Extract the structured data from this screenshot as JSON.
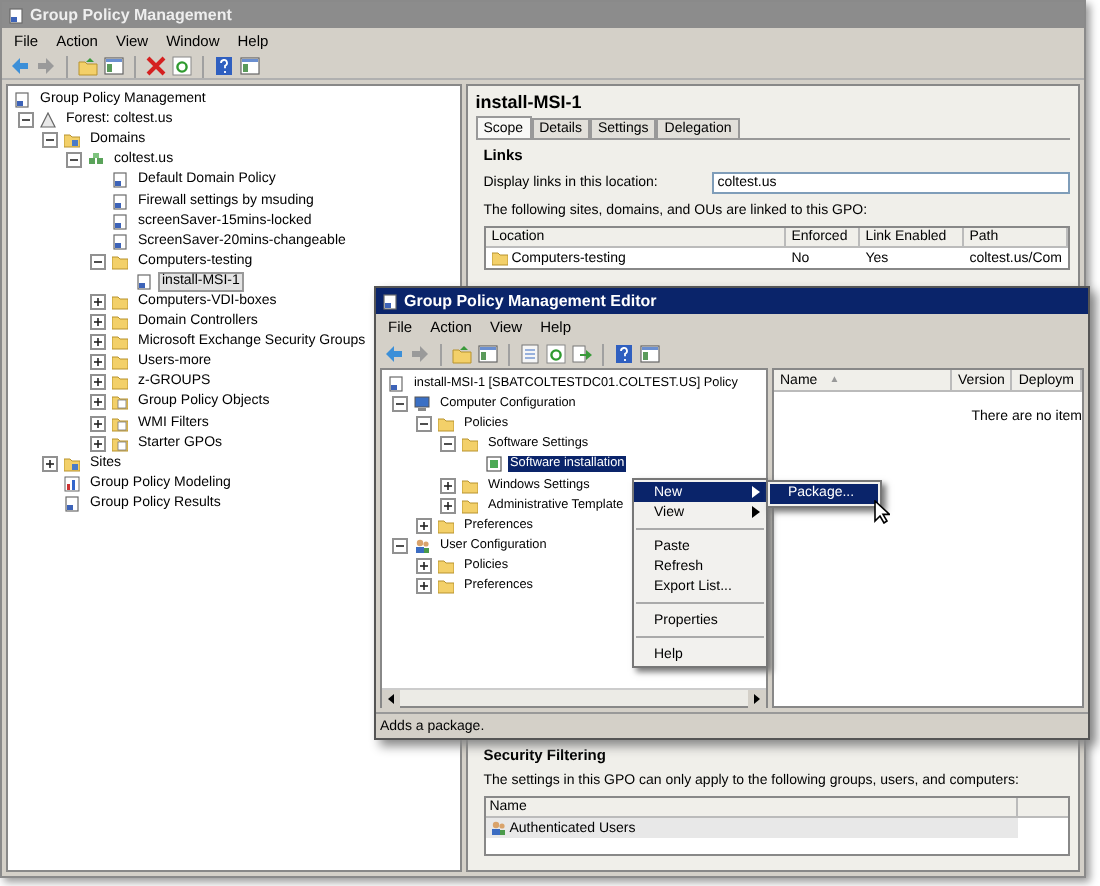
{
  "main_window": {
    "title": "Group Policy Management",
    "menu": [
      "File",
      "Action",
      "View",
      "Window",
      "Help"
    ],
    "tree": [
      {
        "label": "Group Policy Management",
        "kind": "console",
        "selected": false,
        "children": [
          {
            "label": "Forest: coltest.us",
            "kind": "forest",
            "expanded": true,
            "selected": false,
            "children": [
              {
                "label": "Domains",
                "kind": "domains",
                "expanded": true,
                "selected": false,
                "children": [
                  {
                    "label": "coltest.us",
                    "kind": "domain",
                    "expanded": true,
                    "selected": false,
                    "children": [
                      {
                        "label": "Default Domain Policy",
                        "kind": "gpo",
                        "selected": false
                      },
                      {
                        "label": "Firewall settings by msuding",
                        "kind": "gpo",
                        "selected": false
                      },
                      {
                        "label": "screenSaver-15mins-locked",
                        "kind": "gpo",
                        "selected": false
                      },
                      {
                        "label": "ScreenSaver-20mins-changeable",
                        "kind": "gpo",
                        "selected": false
                      },
                      {
                        "label": "Computers-testing",
                        "kind": "folder",
                        "expanded": true,
                        "selected": false,
                        "children": [
                          {
                            "label": "install-MSI-1",
                            "kind": "gpo",
                            "selected": true
                          }
                        ]
                      },
                      {
                        "label": "Computers-VDI-boxes",
                        "kind": "folder",
                        "expanded": false,
                        "selected": false
                      },
                      {
                        "label": "Domain Controllers",
                        "kind": "folder",
                        "expanded": false,
                        "selected": false
                      },
                      {
                        "label": "Microsoft Exchange Security Groups",
                        "kind": "folder",
                        "expanded": false,
                        "selected": false
                      },
                      {
                        "label": "Users-more",
                        "kind": "folder",
                        "expanded": false,
                        "selected": false
                      },
                      {
                        "label": "z-GROUPS",
                        "kind": "folder",
                        "expanded": false,
                        "selected": false
                      },
                      {
                        "label": "Group Policy Objects",
                        "kind": "gpo-folder",
                        "expanded": false,
                        "selected": false
                      },
                      {
                        "label": "WMI Filters",
                        "kind": "gpo-folder",
                        "expanded": false,
                        "selected": false
                      },
                      {
                        "label": "Starter GPOs",
                        "kind": "gpo-folder",
                        "expanded": false,
                        "selected": false
                      }
                    ]
                  }
                ]
              },
              {
                "label": "Sites",
                "kind": "sites",
                "expanded": false,
                "selected": false
              },
              {
                "label": "Group Policy Modeling",
                "kind": "modeling",
                "selected": false
              },
              {
                "label": "Group Policy Results",
                "kind": "results",
                "selected": false
              }
            ]
          }
        ]
      }
    ],
    "details": {
      "title": "install-MSI-1",
      "tabs": [
        {
          "label": "Scope",
          "selected": true
        },
        {
          "label": "Details",
          "selected": false
        },
        {
          "label": "Settings",
          "selected": false
        },
        {
          "label": "Delegation",
          "selected": false
        }
      ],
      "links_heading": "Links",
      "display_links_label": "Display links in this location:",
      "location_value": "coltest.us",
      "linked_text": "The following sites, domains, and OUs are linked to this GPO:",
      "links_table": {
        "columns": [
          "Location",
          "Enforced",
          "Link Enabled",
          "Path"
        ],
        "rows": [
          [
            "Computers-testing",
            "No",
            "Yes",
            "coltest.us/Com"
          ]
        ]
      },
      "security_heading": "Security Filtering",
      "security_text": "The settings in this GPO can only apply to the following groups, users, and computers:",
      "security_table": {
        "columns": [
          "Name"
        ],
        "rows": [
          [
            "Authenticated Users"
          ]
        ]
      }
    }
  },
  "editor_window": {
    "title": "Group Policy Management Editor",
    "menu": [
      "File",
      "Action",
      "View",
      "Help"
    ],
    "tree": [
      {
        "label": "install-MSI-1 [SBATCOLTESTDC01.COLTEST.US] Policy",
        "kind": "policy",
        "selected": false,
        "children": [
          {
            "label": "Computer Configuration",
            "kind": "computer",
            "expanded": true,
            "selected": false,
            "children": [
              {
                "label": "Policies",
                "kind": "folder",
                "expanded": true,
                "selected": false,
                "children": [
                  {
                    "label": "Software Settings",
                    "kind": "folder",
                    "expanded": true,
                    "selected": false,
                    "children": [
                      {
                        "label": "Software installation",
                        "kind": "software",
                        "selected": true
                      }
                    ]
                  },
                  {
                    "label": "Windows Settings",
                    "kind": "folder",
                    "expanded": false,
                    "selected": false
                  },
                  {
                    "label": "Administrative Template",
                    "kind": "folder",
                    "expanded": false,
                    "selected": false
                  }
                ]
              },
              {
                "label": "Preferences",
                "kind": "folder",
                "expanded": false,
                "selected": false
              }
            ]
          },
          {
            "label": "User Configuration",
            "kind": "user",
            "expanded": true,
            "selected": false,
            "children": [
              {
                "label": "Policies",
                "kind": "folder",
                "expanded": false,
                "selected": false
              },
              {
                "label": "Preferences",
                "kind": "folder",
                "expanded": false,
                "selected": false
              }
            ]
          }
        ]
      }
    ],
    "list": {
      "columns": [
        "Name",
        "Version",
        "Deploym"
      ],
      "sort_mark": "▲",
      "empty_text": "There are no item"
    },
    "status_bar": "Adds a package."
  },
  "context_menu": {
    "items": [
      {
        "kind": "item",
        "label": "New",
        "submenu": true,
        "selected": true
      },
      {
        "kind": "item",
        "label": "View",
        "submenu": true,
        "selected": false
      },
      {
        "kind": "separator"
      },
      {
        "kind": "item",
        "label": "Paste",
        "submenu": false,
        "selected": false
      },
      {
        "kind": "item",
        "label": "Refresh",
        "submenu": false,
        "selected": false
      },
      {
        "kind": "item",
        "label": "Export List...",
        "submenu": false,
        "selected": false
      },
      {
        "kind": "separator"
      },
      {
        "kind": "item",
        "label": "Properties",
        "submenu": false,
        "selected": false
      },
      {
        "kind": "separator"
      },
      {
        "kind": "item",
        "label": "Help",
        "submenu": false,
        "selected": false
      }
    ]
  },
  "submenu": {
    "items": [
      {
        "kind": "item",
        "label": "Package...",
        "selected": true
      }
    ]
  }
}
